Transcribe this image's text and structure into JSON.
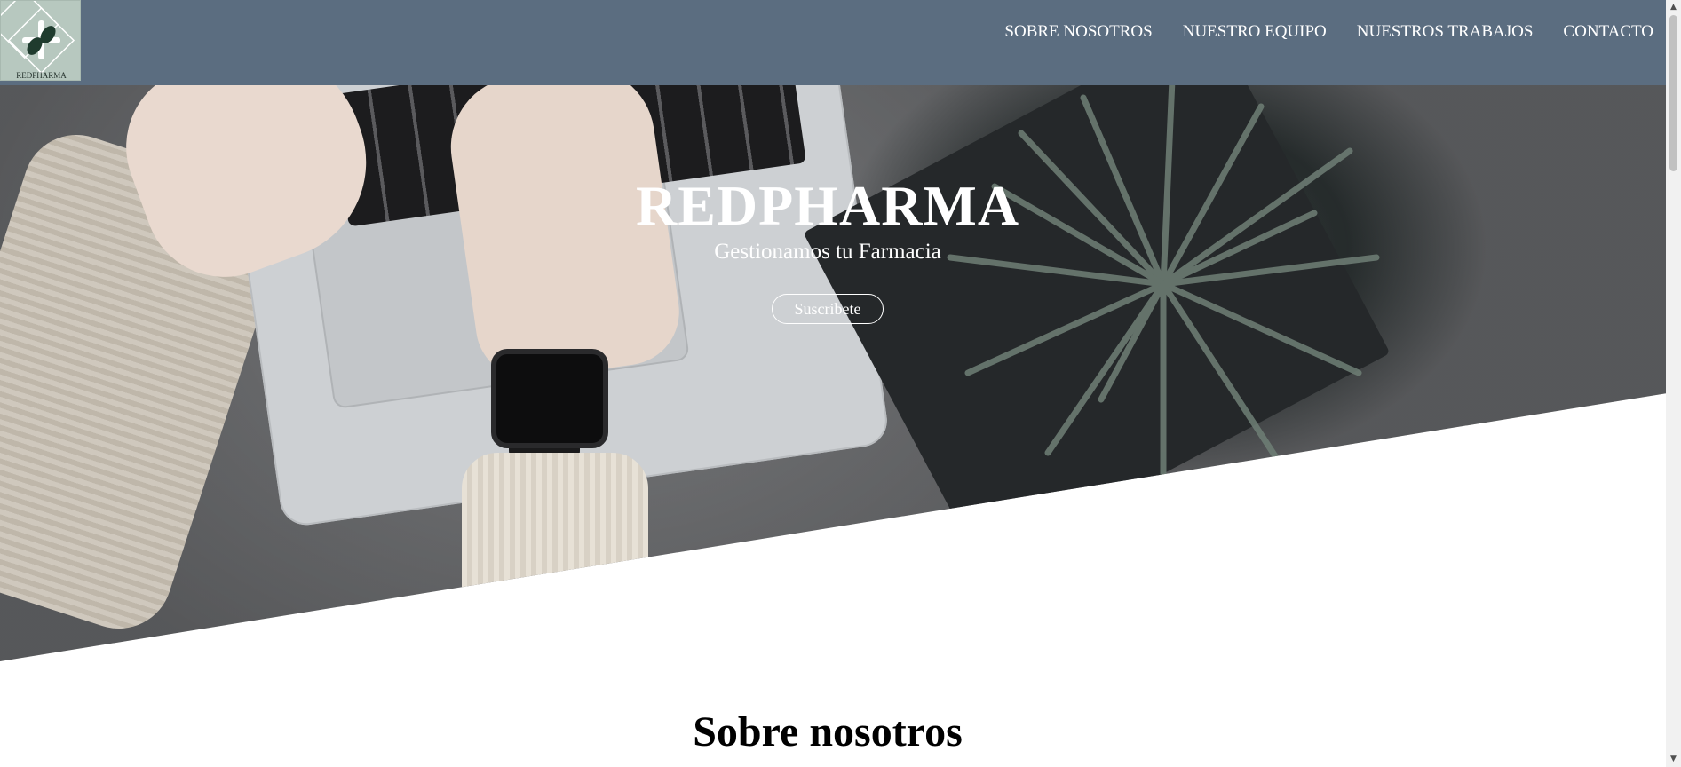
{
  "header": {
    "logo_text": "REDPHARMA",
    "nav": [
      {
        "label": "SOBRE NOSOTROS"
      },
      {
        "label": "NUESTRO EQUIPO"
      },
      {
        "label": "NUESTROS TRABAJOS"
      },
      {
        "label": "CONTACTO"
      }
    ],
    "background_color": "#5b6d80"
  },
  "hero": {
    "title": "REDPHARMA",
    "subtitle": "Gestionamos tu Farmacia",
    "cta_label": "Suscribete"
  },
  "about": {
    "title": "Sobre nosotros"
  },
  "icons": {
    "logo": "pharmacy-cross-diamond-icon",
    "scroll_up": "triangle-up-icon",
    "scroll_down": "triangle-down-icon"
  }
}
